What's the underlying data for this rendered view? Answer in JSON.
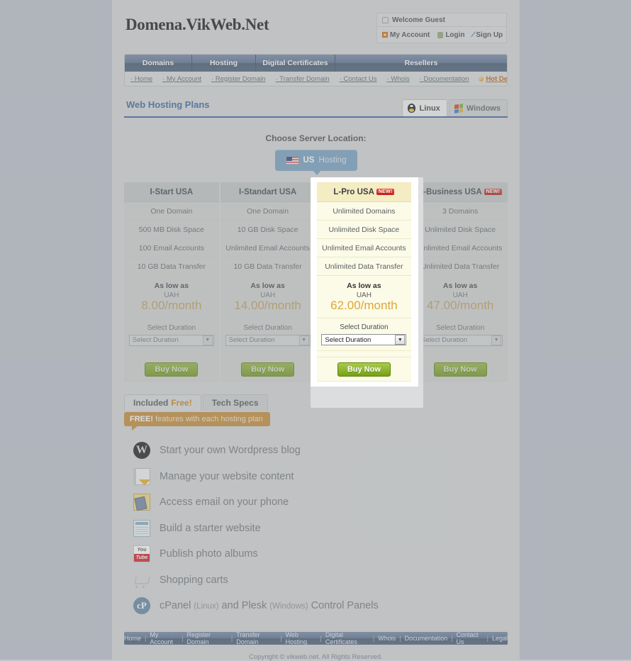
{
  "site": {
    "logo": "Domena.VikWeb.Net",
    "copyright": "Copyright © vikweb.net. All Rights Reserved."
  },
  "userbox": {
    "welcome": "Welcome Guest",
    "my_account": "My Account",
    "login": "Login",
    "sign_up": "Sign Up"
  },
  "nav": {
    "primary": [
      {
        "label": "Domains"
      },
      {
        "label": "Hosting"
      },
      {
        "label": "Digital Certificates"
      },
      {
        "label": "Resellers"
      }
    ],
    "secondary": [
      {
        "label": "Home"
      },
      {
        "label": "My Account"
      },
      {
        "label": "Register Domain"
      },
      {
        "label": "Transfer Domain"
      },
      {
        "label": "Contact Us"
      },
      {
        "label": "Whois"
      },
      {
        "label": "Documentation"
      }
    ],
    "hot_deals": "Hot Deals!!!"
  },
  "section": {
    "title": "Web Hosting Plans",
    "os_tabs": [
      {
        "label": "Linux",
        "active": true
      },
      {
        "label": "Windows",
        "active": false
      }
    ]
  },
  "location": {
    "label": "Choose Server Location:",
    "button_bold": "US",
    "button_rest": "Hosting"
  },
  "plans": {
    "currency": "UAH",
    "as_low_as": "As low as",
    "duration_label": "Select Duration",
    "duration_value": "Select Duration",
    "buy_label": "Buy Now",
    "new_badge": "NEW!",
    "items": [
      {
        "name": "I-Start USA",
        "new": false,
        "highlighted": false,
        "features": [
          "One Domain",
          "500 MB Disk Space",
          "100 Email Accounts",
          "10 GB Data Transfer"
        ],
        "price": "8.00/month"
      },
      {
        "name": "I-Standart USA",
        "new": false,
        "highlighted": false,
        "features": [
          "One Domain",
          "10 GB Disk Space",
          "Unlimited Email Accounts",
          "10 GB Data Transfer"
        ],
        "price": "14.00/month"
      },
      {
        "name": "L-Pro USA",
        "new": true,
        "highlighted": true,
        "features": [
          "Unlimited Domains",
          "Unlimited Disk Space",
          "Unlimited Email Accounts",
          "Unlimited Data Transfer"
        ],
        "price": "62.00/month"
      },
      {
        "name": "L-Business USA",
        "new": true,
        "highlighted": false,
        "features": [
          "3 Domains",
          "Unlimited Disk Space",
          "Unlimited Email Accounts",
          "Unlimited Data Transfer"
        ],
        "price": "47.00/month"
      }
    ]
  },
  "feature_tabs": [
    {
      "label": "Included",
      "accent": "Free!",
      "active": true
    },
    {
      "label": "Tech Specs",
      "accent": "",
      "active": false
    }
  ],
  "tooltip": {
    "bold": "FREE!",
    "rest": "features with each hosting plan"
  },
  "features": [
    {
      "icon": "wordpress-icon",
      "text": "Start your own Wordpress blog"
    },
    {
      "icon": "document-edit-icon",
      "text": "Manage your website content"
    },
    {
      "icon": "mobile-email-icon",
      "text": "Access email on your phone"
    },
    {
      "icon": "website-builder-icon",
      "text": "Build a starter website"
    },
    {
      "icon": "youtube-icon",
      "text": "Publish photo albums"
    },
    {
      "icon": "shopping-cart-icon",
      "text": "Shopping carts"
    },
    {
      "icon": "cpanel-icon",
      "text": "cPanel (Linux) and Plesk (Windows) Control Panels",
      "parts": [
        {
          "t": "cPanel ",
          "sm": false
        },
        {
          "t": "(Linux)",
          "sm": true
        },
        {
          "t": " and Plesk ",
          "sm": false
        },
        {
          "t": "(Windows)",
          "sm": true
        },
        {
          "t": " Control Panels",
          "sm": false
        }
      ]
    }
  ],
  "footer_links": [
    "Home",
    "My Account",
    "Register Domain",
    "Transfer Domain",
    "Web Hosting",
    "Digital Certificates",
    "Whois",
    "Documentation",
    "Contact Us",
    "Legal"
  ],
  "colors": {
    "nav_blue": "#5f7490",
    "accent_blue": "#4a6ea8",
    "price_gold": "#c3a568",
    "price_gold_bright": "#e1a637",
    "buy_green": "#7d9e33",
    "tooltip_orange": "#c79344",
    "new_red": "#c32018",
    "page_bg": "#c0c5ce",
    "content_bg": "#d7d9d8",
    "highlight_bg": "#fbfbe8"
  }
}
